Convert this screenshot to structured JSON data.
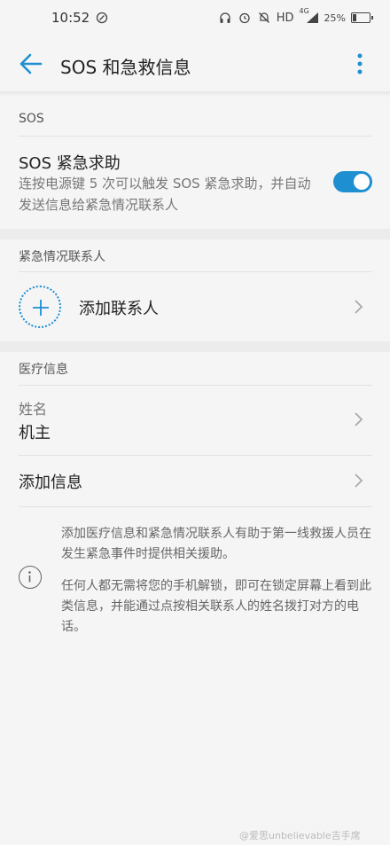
{
  "status_bar": {
    "time": "10:52",
    "network": "HD",
    "signal_label": "4G",
    "battery": "25%",
    "battery_level": 0.25
  },
  "app_bar": {
    "title": "SOS 和急救信息"
  },
  "sections": {
    "sos": {
      "header": "SOS",
      "toggle_title": "SOS 紧急求助",
      "toggle_desc": "连按电源键 5 次可以触发 SOS 紧急求助，并自动发送信息给紧急情况联系人",
      "toggle_on": true
    },
    "contacts": {
      "header": "紧急情况联系人",
      "add_label": "添加联系人"
    },
    "medical": {
      "header": "医疗信息",
      "name_label": "姓名",
      "name_value": "机主",
      "add_info_label": "添加信息"
    }
  },
  "info": {
    "paragraph1": "添加医疗信息和紧急情况联系人有助于第一线救援人员在发生紧急事件时提供相关援助。",
    "paragraph2": "任何人都无需将您的手机解锁，即可在锁定屏幕上看到此类信息，并能通过点按相关联系人的姓名拨打对方的电话。"
  },
  "watermark": "@爱思unbelievable吉手席",
  "colors": {
    "accent": "#1e8fd0",
    "background": "#f5f5f5"
  }
}
